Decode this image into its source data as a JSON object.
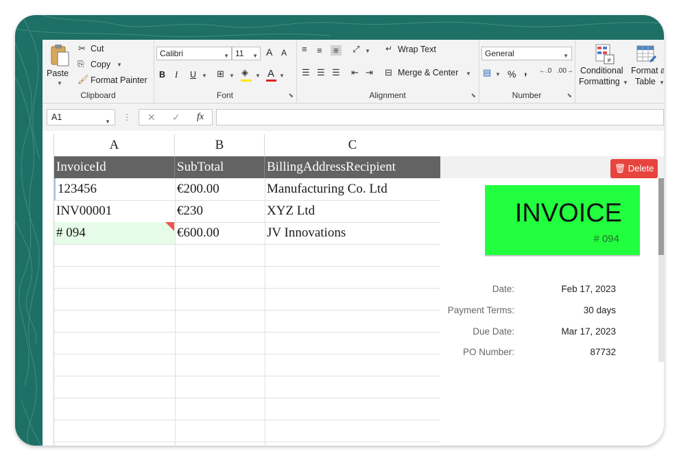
{
  "ribbon": {
    "clipboard": {
      "paste": "Paste",
      "cut": "Cut",
      "copy": "Copy",
      "format_painter": "Format Painter",
      "label": "Clipboard"
    },
    "font": {
      "name": "Calibri",
      "size": "11",
      "bold": "B",
      "italic": "I",
      "underline": "U",
      "grow": "A",
      "shrink": "A",
      "color_letter": "A",
      "label": "Font"
    },
    "alignment": {
      "wrap_text": "Wrap Text",
      "merge_center": "Merge & Center",
      "label": "Alignment"
    },
    "number": {
      "format": "General",
      "percent": "%",
      "comma": ",",
      "label": "Number"
    },
    "styles": {
      "conditional_1": "Conditional",
      "conditional_2": "Formatting",
      "format_table_1": "Format a",
      "format_table_2": "Table"
    }
  },
  "formula_bar": {
    "name_box": "A1",
    "fx": "fx",
    "cancel": "✕",
    "enter": "✓",
    "formula": ""
  },
  "grid": {
    "columns": [
      "A",
      "B",
      "C"
    ],
    "headers": [
      "InvoiceId",
      "SubTotal",
      "BillingAddressRecipient"
    ],
    "rows": [
      [
        "123456",
        "€200.00",
        "Manufacturing Co. Ltd"
      ],
      [
        "INV00001",
        "€230",
        "XYZ Ltd"
      ],
      [
        "# 094",
        "€600.00",
        "JV Innovations"
      ]
    ]
  },
  "preview": {
    "delete_label": "Delete",
    "banner_title": "INVOICE",
    "banner_number": "# 094",
    "fields": [
      {
        "label": "Date:",
        "value": "Feb 17, 2023"
      },
      {
        "label": "Payment Terms:",
        "value": "30 days"
      },
      {
        "label": "Due Date:",
        "value": "Mar 17, 2023"
      },
      {
        "label": "PO Number:",
        "value": "87732"
      }
    ]
  },
  "colors": {
    "frame": "#1e6f65",
    "header_row": "#636363",
    "delete": "#e8443e",
    "banner": "#22ff3f",
    "selected_cell": "#e7fbe9"
  }
}
